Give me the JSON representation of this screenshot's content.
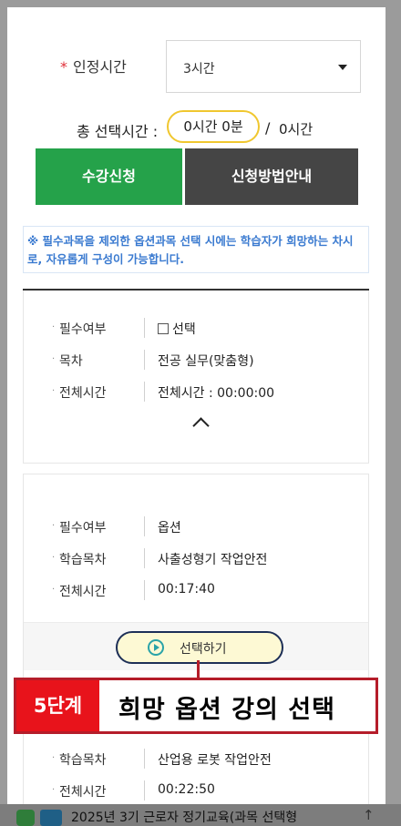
{
  "form": {
    "required_mark": "*",
    "cert_time_label": "인정시간",
    "cert_time_value": "3시간",
    "total_label": "총 선택시간 :",
    "total_selected": "0시간 0분",
    "total_slash": "/",
    "total_max": "0시간"
  },
  "buttons": {
    "apply": "수강신청",
    "guide": "신청방법안내"
  },
  "notice": "※ 필수과목을 제외한 옵션과목 선택 시에는 학습자가 희망하는 차시로, 자유롭게 구성이 가능합니다.",
  "cards": [
    {
      "rows": [
        {
          "key": "필수여부",
          "value": "선택",
          "checkbox": true
        },
        {
          "key": "목차",
          "value": "전공 실무(맞춤형)"
        },
        {
          "key": "전체시간",
          "value": "전체시간 : 00:00:00"
        }
      ]
    },
    {
      "rows": [
        {
          "key": "필수여부",
          "value": "옵션"
        },
        {
          "key": "학습목차",
          "value": "사출성형기 작업안전"
        },
        {
          "key": "전체시간",
          "value": "00:17:40"
        }
      ],
      "select_button": "선택하기"
    },
    {
      "rows": [
        {
          "key": "학습목차",
          "value": "산업용 로봇 작업안전"
        },
        {
          "key": "전체시간",
          "value": "00:22:50"
        }
      ]
    }
  ],
  "step": {
    "number": "5단계",
    "text": "희망 옵션 강의 선택"
  },
  "bottom_bar": {
    "text": "2025년 3기 근로자 정기교육(과목 선택형",
    "arrow": "↑"
  },
  "colors": {
    "apply_green": "#25a24a",
    "guide_dark": "#454545",
    "notice_blue": "#3a7ad0",
    "highlight_yellow": "#f0c72f",
    "step_red": "#e8131b",
    "border_red": "#b51d2a"
  }
}
